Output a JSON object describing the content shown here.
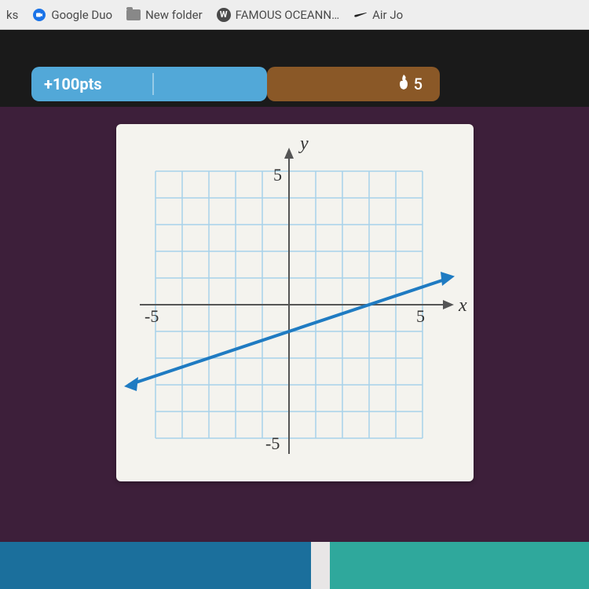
{
  "bookmarks": {
    "truncated": "ks",
    "items": [
      {
        "label": "Google Duo"
      },
      {
        "label": "New folder"
      },
      {
        "label": "FAMOUS OCEANN…"
      },
      {
        "label": "Air Jo"
      }
    ]
  },
  "score": {
    "points_label": "+100pts",
    "streak_value": "5"
  },
  "colors": {
    "pill_blue": "#52a8d8",
    "pill_brown": "#8a5827",
    "content_bg": "#3d1f3a",
    "grid_line": "#a7d2ea",
    "line_stroke": "#1f7bc2"
  },
  "chart_data": {
    "type": "line",
    "title": "",
    "xlabel": "x",
    "ylabel": "y",
    "xlim": [
      -6,
      6
    ],
    "ylim": [
      -6,
      6
    ],
    "x_ticks": [
      -5,
      5
    ],
    "y_ticks": [
      -5,
      5
    ],
    "grid": true,
    "x": [
      -6,
      6
    ],
    "y": [
      -3,
      1
    ],
    "equation": "y = (1/3)x - 1",
    "slope": 0.3333,
    "intercept": -1
  }
}
